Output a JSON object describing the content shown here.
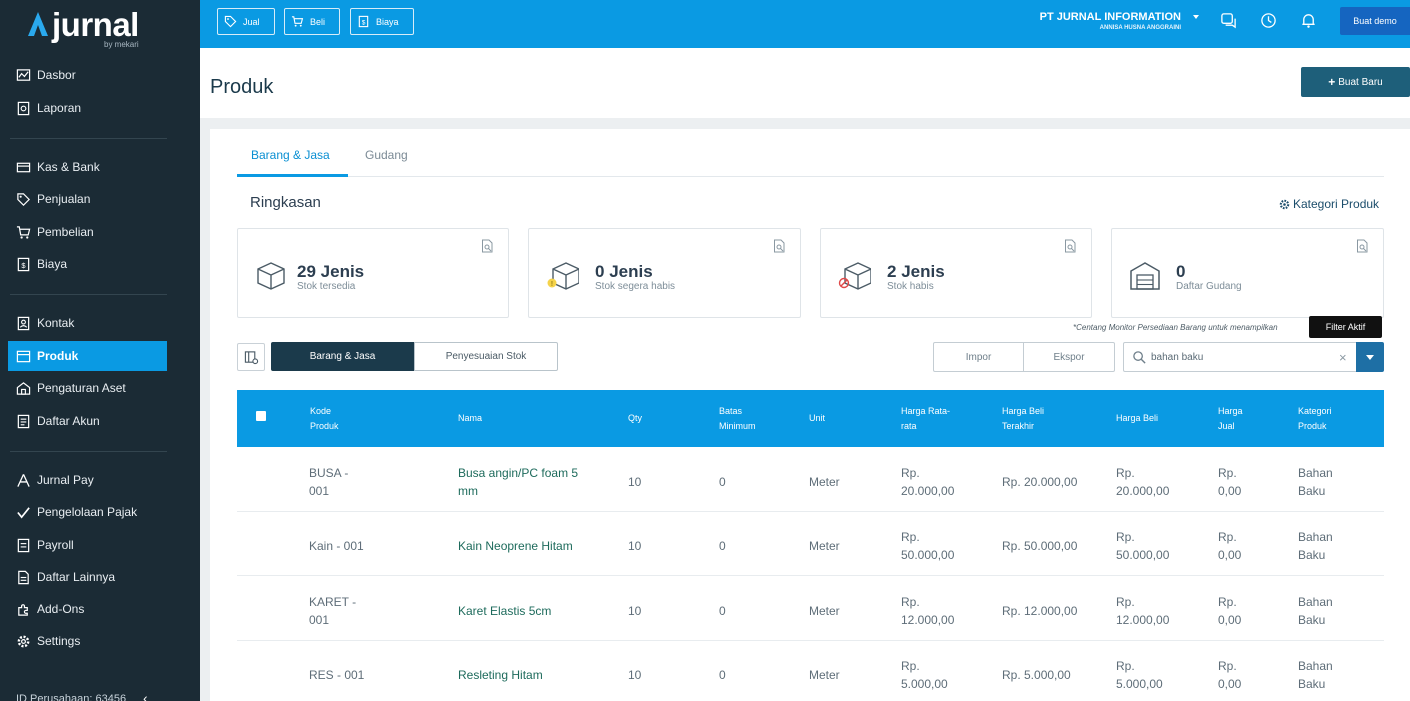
{
  "brand": {
    "name": "jurnal",
    "tagline": "by mekari"
  },
  "sidebar": {
    "items": [
      {
        "label": "Dasbor",
        "icon": "dashboard-icon"
      },
      {
        "label": "Laporan",
        "icon": "report-icon"
      },
      {
        "label": "Kas & Bank",
        "icon": "bank-icon"
      },
      {
        "label": "Penjualan",
        "icon": "tag-icon"
      },
      {
        "label": "Pembelian",
        "icon": "cart-icon"
      },
      {
        "label": "Biaya",
        "icon": "receipt-icon"
      },
      {
        "label": "Kontak",
        "icon": "contact-icon"
      },
      {
        "label": "Produk",
        "icon": "box-icon",
        "active": true
      },
      {
        "label": "Pengaturan Aset",
        "icon": "asset-icon"
      },
      {
        "label": "Daftar Akun",
        "icon": "list-icon"
      },
      {
        "label": "Jurnal Pay",
        "icon": "pay-icon"
      },
      {
        "label": "Pengelolaan Pajak",
        "icon": "tax-icon"
      },
      {
        "label": "Payroll",
        "icon": "payroll-icon"
      },
      {
        "label": "Daftar Lainnya",
        "icon": "document-icon"
      },
      {
        "label": "Add-Ons",
        "icon": "puzzle-icon"
      },
      {
        "label": "Settings",
        "icon": "gear-icon"
      }
    ],
    "company_id": "ID Perusahaan: 63456"
  },
  "topbar": {
    "buttons": [
      "Jual",
      "Beli",
      "Biaya"
    ],
    "company_name": "PT JURNAL INFORMATION",
    "user_name": "ANNISA HUSNA ANGGRAINI",
    "demo_label": "Buat demo"
  },
  "page": {
    "title": "Produk",
    "new_button": "Buat Baru"
  },
  "tabs": [
    "Barang & Jasa",
    "Gudang"
  ],
  "summary": {
    "title": "Ringkasan",
    "category_link": "Kategori Produk",
    "cards": [
      {
        "value": "29",
        "unit": "Jenis",
        "label": "Stok tersedia"
      },
      {
        "value": "0",
        "unit": "Jenis",
        "label": "Stok segera habis"
      },
      {
        "value": "2",
        "unit": "Jenis",
        "label": "Stok habis"
      },
      {
        "value": "0",
        "unit": "",
        "label": "Daftar Gudang"
      }
    ]
  },
  "note": "*Centang Monitor Persediaan Barang untuk menampilkan",
  "tooltip": "Filter Aktif",
  "toolbar": {
    "segments": [
      "Barang & Jasa",
      "Penyesuaian Stok"
    ],
    "import_label": "Impor",
    "export_label": "Ekspor",
    "search_value": "bahan baku"
  },
  "table": {
    "headers": {
      "kode": "Kode\nProduk",
      "nama": "Nama",
      "qty": "Qty",
      "batas": "Batas\nMinimum",
      "unit": "Unit",
      "rata": "Harga Rata-\nrata",
      "beli_terakhir": "Harga Beli\nTerakhir",
      "beli": "Harga Beli",
      "jual": "Harga\nJual",
      "kategori": "Kategori\nProduk"
    },
    "rows": [
      {
        "kode": "BUSA -\n001",
        "nama": "Busa angin/PC foam 5\nmm",
        "qty": "10",
        "batas": "0",
        "unit": "Meter",
        "rata": "Rp.\n20.000,00",
        "beli_terakhir": "Rp. 20.000,00",
        "beli": "Rp.\n20.000,00",
        "jual": "Rp.\n0,00",
        "kategori": "Bahan\nBaku"
      },
      {
        "kode": "Kain - 001",
        "nama": "Kain Neoprene Hitam",
        "qty": "10",
        "batas": "0",
        "unit": "Meter",
        "rata": "Rp.\n50.000,00",
        "beli_terakhir": "Rp. 50.000,00",
        "beli": "Rp.\n50.000,00",
        "jual": "Rp.\n0,00",
        "kategori": "Bahan\nBaku"
      },
      {
        "kode": "KARET -\n001",
        "nama": "Karet Elastis 5cm",
        "qty": "10",
        "batas": "0",
        "unit": "Meter",
        "rata": "Rp.\n12.000,00",
        "beli_terakhir": "Rp. 12.000,00",
        "beli": "Rp.\n12.000,00",
        "jual": "Rp.\n0,00",
        "kategori": "Bahan\nBaku"
      },
      {
        "kode": "RES - 001",
        "nama": "Resleting Hitam",
        "qty": "10",
        "batas": "0",
        "unit": "Meter",
        "rata": "Rp.\n5.000,00",
        "beli_terakhir": "Rp. 5.000,00",
        "beli": "Rp.\n5.000,00",
        "jual": "Rp.\n0,00",
        "kategori": "Bahan\nBaku"
      }
    ]
  },
  "colors": {
    "primary": "#0a9ae3",
    "sidebar": "#1b2b35",
    "dark": "#1b3a4b"
  }
}
